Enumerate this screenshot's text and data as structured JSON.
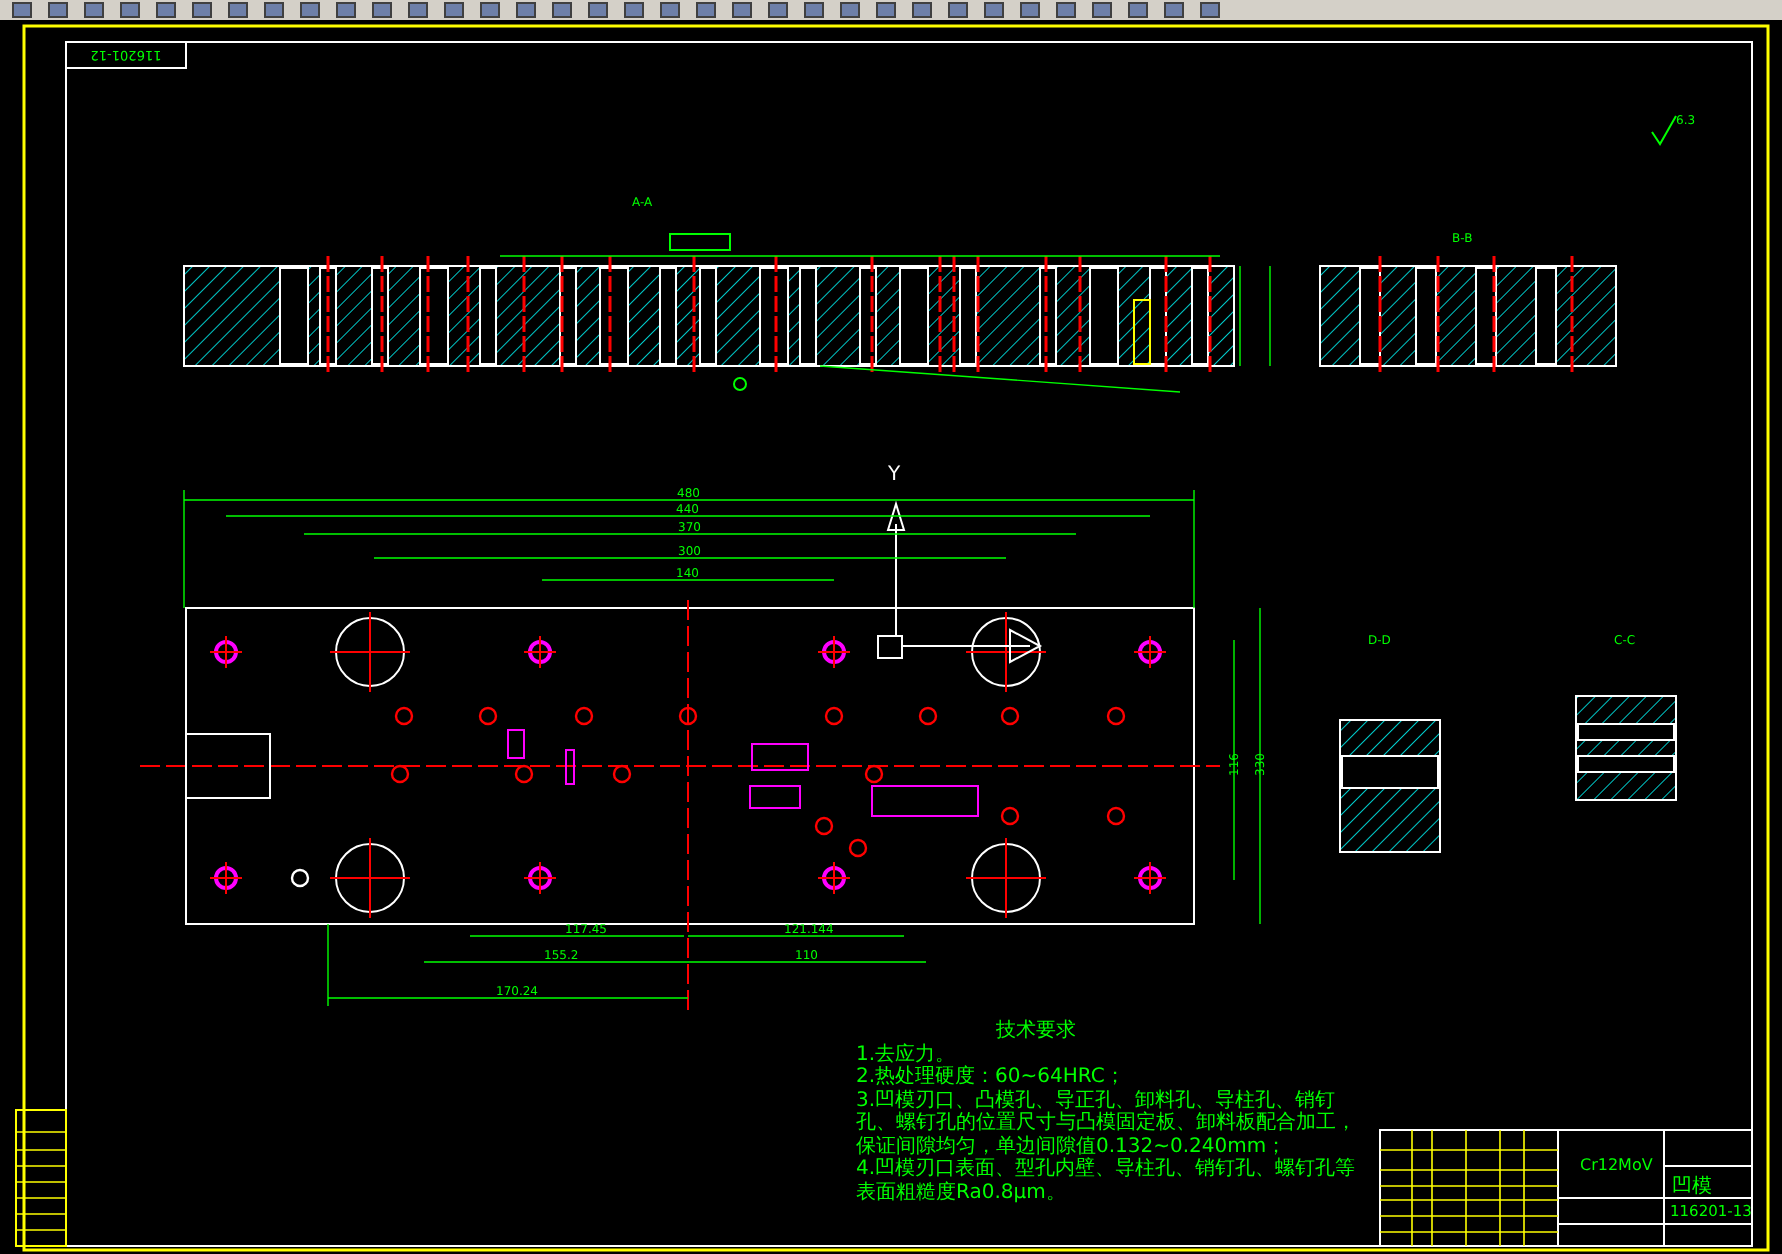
{
  "drawing_frame": {
    "tag": "116201-12"
  },
  "views": [
    {
      "label": "A-A",
      "kind": "section-long"
    },
    {
      "label": "B-B",
      "kind": "section-short"
    },
    {
      "label": "D-D",
      "kind": "detail-d"
    },
    {
      "label": "C-C",
      "kind": "detail-c"
    }
  ],
  "view_direction": "Y",
  "roughness": "6.3",
  "plan_dimensions": [
    "480",
    "440",
    "370",
    "300",
    "140",
    "117.45",
    "121.144",
    "155.2",
    "110",
    "170.24",
    "330",
    "116"
  ],
  "technical_requirements": {
    "title": "技术要求",
    "items": [
      "1.去应力。",
      "2.热处理硬度：60~64HRC；",
      "3.凹模刃口、凸模孔、导正孔、卸料孔、导柱孔、销钉孔、螺钉孔的位置尺寸与凸模固定板、卸料板配合加工，保证间隙均匀，单边间隙值0.132~0.240mm；",
      "4.凹模刃口表面、型孔内壁、导柱孔、销钉孔、螺钉孔等表面粗糙度Ra0.8μm。"
    ]
  },
  "title_block": {
    "part_name": "凹模",
    "material": "Cr12MoV",
    "drawing_number": "116201-13"
  }
}
